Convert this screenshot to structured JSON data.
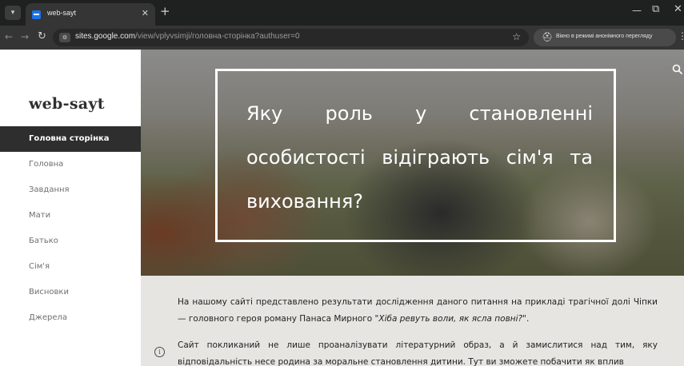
{
  "browser": {
    "tab_title": "web-sayt",
    "url_host": "sites.google.com",
    "url_path": "/view/vplyvsimji/головна-сторінка?authuser=0",
    "incognito_label": "Вікно в режимі анонімного перегляду",
    "icons": {
      "tab_menu": "▾",
      "tab_close": "✕",
      "new_tab": "+",
      "back": "←",
      "forward": "→",
      "reload": "↻",
      "site_info": "⚙",
      "star": "☆",
      "incognito": "⛑",
      "minimize": "—",
      "restore": "⧉",
      "close": "✕",
      "menu": "⋮"
    }
  },
  "site": {
    "title": "web-sayt",
    "nav": [
      {
        "label": "Головна сторінка",
        "active": true
      },
      {
        "label": "Головна"
      },
      {
        "label": "Завдання"
      },
      {
        "label": "Мати"
      },
      {
        "label": "Батько"
      },
      {
        "label": "Сім'я"
      },
      {
        "label": "Висновки"
      },
      {
        "label": "Джерела"
      }
    ]
  },
  "hero": {
    "heading": "Яку роль у становленні особистості відіграють сім'я та виховання?"
  },
  "content": {
    "paragraph1_prefix": "На нашому сайті представлено результати дослідження даного питання на прикладі трагічної долі Чіпки — головного героя роману Панаса Мирного ",
    "paragraph1_title": "\"Хіба ревуть воли, як ясла повні?\"",
    "paragraph1_suffix": ".",
    "paragraph2": "Сайт покликаний не лише проаналізувати літературний образ, а й замислитися над тим, яку відповідальність несе родина за моральне становлення дитини. Тут ви зможете побачити як вплив",
    "info_icon": "i"
  },
  "colors": {
    "sidebar_active_bg": "#2e2e2e",
    "content_bg": "#e6e5e1",
    "chrome_bg": "#1f2020"
  }
}
